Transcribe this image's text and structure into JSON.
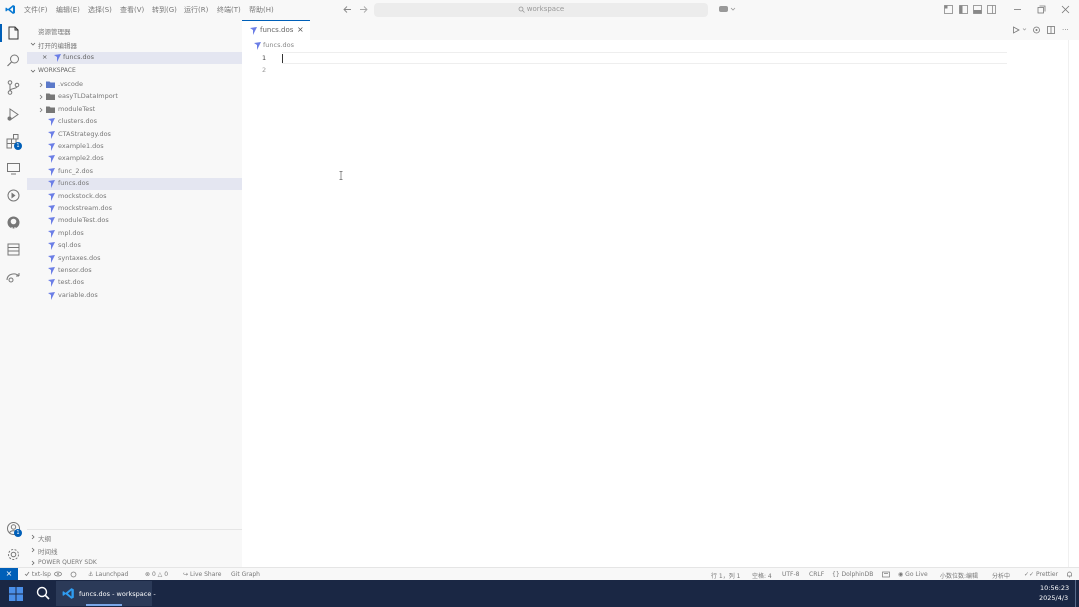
{
  "menu": [
    "文件(F)",
    "编辑(E)",
    "选择(S)",
    "查看(V)",
    "转到(G)",
    "运行(R)",
    "终端(T)",
    "帮助(H)"
  ],
  "command_center": {
    "label": "workspace"
  },
  "activity_badges": {
    "extensions": "1",
    "accounts": "1"
  },
  "sidebar": {
    "title": "资源管理器",
    "open_editors": {
      "label": "打开的编辑器",
      "items": [
        {
          "close": "×",
          "name": "funcs.dos"
        }
      ]
    },
    "workspace": {
      "label": "WORKSPACE",
      "folders": [
        ".vscode",
        "easyTLDataImport",
        "moduleTest"
      ],
      "files": [
        "clusters.dos",
        "CTAStrategy.dos",
        "example1.dos",
        "example2.dos",
        "func_2.dos",
        "funcs.dos",
        "mockstock.dos",
        "mockstream.dos",
        "moduleTest.dos",
        "mpl.dos",
        "sql.dos",
        "syntaxes.dos",
        "tensor.dos",
        "test.dos",
        "variable.dos"
      ],
      "selected_file": "funcs.dos"
    },
    "bottom_sections": [
      "大纲",
      "时间线",
      "POWER QUERY SDK"
    ]
  },
  "editor": {
    "tab": {
      "name": "funcs.dos",
      "close": "×"
    },
    "breadcrumb": "funcs.dos",
    "line_numbers": [
      "1",
      "2"
    ],
    "cursor_line": "1",
    "accent": "#005fb8"
  },
  "statusbar": {
    "remote": "×",
    "left": [
      "txt-lsp",
      "Launchpad",
      "0 △ 0",
      "Live Share",
      "Git Graph"
    ],
    "right": [
      "行 1，列 1",
      "空格: 4",
      "UTF-8",
      "CRLF",
      "{} DolphinDB",
      "Go Live",
      "小数位数:编辑",
      "分析中",
      "Prettier"
    ]
  },
  "taskbar": {
    "app_title": "funcs.dos - workspace -",
    "time": "10:56:23",
    "date": "2025/4/3"
  }
}
